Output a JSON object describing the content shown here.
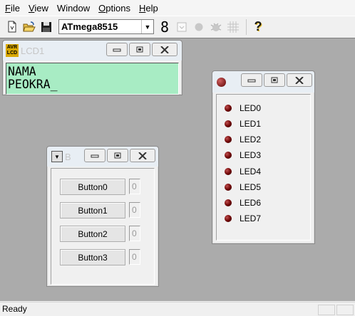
{
  "menu": {
    "file": {
      "accel": "F",
      "rest": "ile"
    },
    "view": {
      "accel": "V",
      "rest": "iew"
    },
    "window": {
      "accel": "",
      "rest": "Window"
    },
    "options": {
      "accel": "O",
      "rest": "ptions"
    },
    "help": {
      "accel": "H",
      "rest": "elp"
    }
  },
  "toolbar": {
    "chip": "ATmega8515",
    "seven_segment_glyph": "8",
    "help_glyph": "?"
  },
  "lcd_window": {
    "icon_text": "AVR\nLCD",
    "title": "LCD1",
    "line1": "NAMA",
    "line2": "PEOKRA_"
  },
  "led_window": {
    "leds": [
      "LED0",
      "LED1",
      "LED2",
      "LED3",
      "LED4",
      "LED5",
      "LED6",
      "LED7"
    ],
    "led_color": "#7a0000"
  },
  "button_window": {
    "title": "B",
    "buttons": [
      {
        "label": "Button0",
        "count": "0"
      },
      {
        "label": "Button1",
        "count": "0"
      },
      {
        "label": "Button2",
        "count": "0"
      },
      {
        "label": "Button3",
        "count": "0"
      }
    ]
  },
  "status": {
    "text": "Ready"
  },
  "colors": {
    "desktop": "#ababab",
    "lcd_background": "#a8ecc4",
    "title_inactive_text": "#c6c6c6"
  }
}
